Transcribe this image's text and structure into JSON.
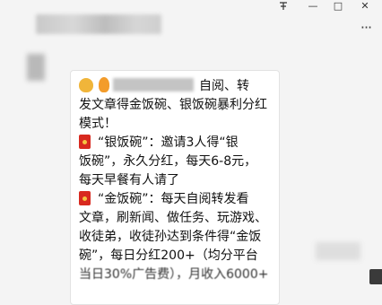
{
  "window": {
    "pin_icon": "pin-icon",
    "minimize_label": "—",
    "maximize_label": "□",
    "close_label": "✕"
  },
  "header": {
    "more_label": "···"
  },
  "message": {
    "lines": [
      "自阅、转",
      "发文章得金饭碗、银饭碗暴利分红",
      "模式！",
      "“银饭碗”：邀请3人得“银",
      "饭碗”，永久分红，每天6-8元，",
      "每天早餐有人请了",
      "“金饭碗”：每天自阅转发看",
      "文章，刷新闻、做任务、玩游戏、",
      "收徒弟，收徒孙达到条件得“金饭",
      "碗”，每日分红200+（均分平台",
      "当日30%广告费），月收入6000+"
    ]
  }
}
